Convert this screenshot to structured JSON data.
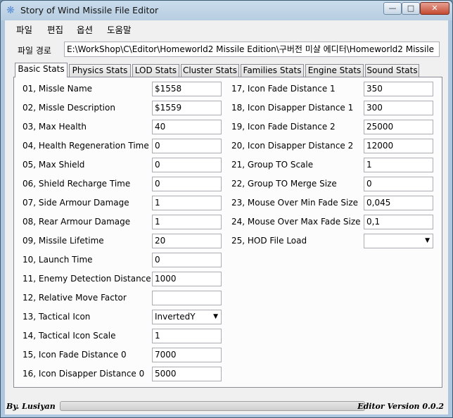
{
  "window": {
    "title": "Story of Wind Missile File Editor",
    "controls": {
      "minimize": "—",
      "maximize": "□",
      "close": "✕"
    }
  },
  "menu": [
    "파일",
    "편집",
    "옵션",
    "도움말"
  ],
  "path": {
    "label": "파일 경로",
    "value": "E:\\WorkShop\\C\\Editor\\Homeworld2 Missile Edition\\구버전 미샬 에디터\\Homeworld2 Missile"
  },
  "tabs": [
    "Basic Stats",
    "Physics Stats",
    "LOD Stats",
    "Cluster Stats",
    "Families Stats",
    "Engine Stats",
    "Sound Stats"
  ],
  "active_tab": "Basic Stats",
  "left_fields": [
    {
      "label": "01, Missle Name",
      "value": "$1558"
    },
    {
      "label": "02, Missle Description",
      "value": "$1559"
    },
    {
      "label": "03, Max Health",
      "value": "40"
    },
    {
      "label": "04, Health Regeneration Time",
      "value": "0"
    },
    {
      "label": "05, Max Shield",
      "value": "0"
    },
    {
      "label": "06, Shield Recharge Time",
      "value": "0"
    },
    {
      "label": "07, Side Armour Damage",
      "value": "1"
    },
    {
      "label": "08, Rear Armour Damage",
      "value": "1"
    },
    {
      "label": "09, Missile Lifetime",
      "value": "20"
    },
    {
      "label": "10, Launch Time",
      "value": "0"
    },
    {
      "label": "11, Enemy Detection Distance",
      "value": "1000"
    },
    {
      "label": "12, Relative Move Factor",
      "value": ""
    },
    {
      "label": "13, Tactical Icon",
      "value": "InvertedY",
      "type": "dropdown"
    },
    {
      "label": "14, Tactical Icon Scale",
      "value": "1"
    },
    {
      "label": "15, Icon Fade Distance 0",
      "value": "7000"
    },
    {
      "label": "16, Icon Disapper Distance 0",
      "value": "5000"
    }
  ],
  "right_fields": [
    {
      "label": "17, Icon Fade Distance 1",
      "value": "350"
    },
    {
      "label": "18, Icon Disapper Distance 1",
      "value": "300"
    },
    {
      "label": "19, Icon Fade Distance 2",
      "value": "25000"
    },
    {
      "label": "20, Icon Disapper Distance 2",
      "value": "12000"
    },
    {
      "label": "21, Group TO Scale",
      "value": "1"
    },
    {
      "label": "22, Group TO Merge Size",
      "value": "0"
    },
    {
      "label": "23, Mouse Over Min Fade Size",
      "value": "0,045"
    },
    {
      "label": "24, Mouse Over Max Fade Size",
      "value": "0,1"
    },
    {
      "label": "25, HOD File Load",
      "value": "",
      "type": "dropdown"
    }
  ],
  "status": {
    "author": "By. Lusiyan",
    "version": "Editor Version 0.0.2",
    "progress": 0
  },
  "colors": {
    "progress_fill": "#37c237",
    "panel_bg": "#fcfcfc",
    "window_frame": "#b7cde1"
  }
}
